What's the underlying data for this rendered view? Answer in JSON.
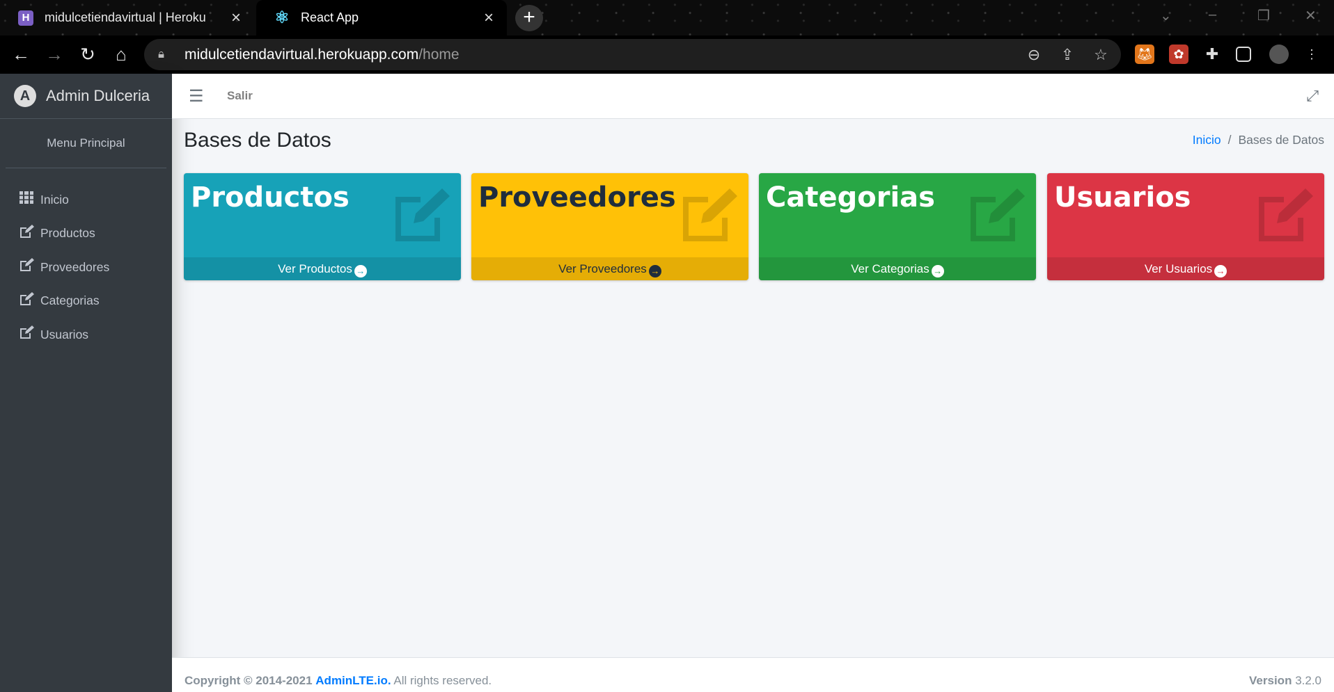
{
  "browser": {
    "tabs": [
      {
        "title": "midulcetiendavirtual | Heroku",
        "favicon": "heroku-icon"
      },
      {
        "title": "React App",
        "favicon": "react-icon"
      }
    ],
    "url_host": "midulcetiendavirtual.herokuapp.com",
    "url_path": "/home"
  },
  "sidebar": {
    "brand": "Admin Dulceria",
    "menu_title": "Menu Principal",
    "items": [
      {
        "label": "Inicio",
        "icon": "grid-icon"
      },
      {
        "label": "Productos",
        "icon": "edit-icon"
      },
      {
        "label": "Proveedores",
        "icon": "edit-icon"
      },
      {
        "label": "Categorias",
        "icon": "edit-icon"
      },
      {
        "label": "Usuarios",
        "icon": "edit-icon"
      }
    ]
  },
  "topnav": {
    "salir": "Salir"
  },
  "content": {
    "title": "Bases de Datos",
    "breadcrumb": {
      "home": "Inicio",
      "current": "Bases de Datos"
    }
  },
  "boxes": [
    {
      "title": "Productos",
      "link": "Ver Productos",
      "color": "#17a2b8",
      "text_color": "#ffffff"
    },
    {
      "title": "Proveedores",
      "link": "Ver Proveedores",
      "color": "#ffc107",
      "text_color": "#1f2d3d"
    },
    {
      "title": "Categorias",
      "link": "Ver Categorias",
      "color": "#28a745",
      "text_color": "#ffffff"
    },
    {
      "title": "Usuarios",
      "link": "Ver Usuarios",
      "color": "#dc3545",
      "text_color": "#ffffff"
    }
  ],
  "footer": {
    "copyright_prefix": "Copyright © 2014-2021",
    "brand": "AdminLTE.io.",
    "rights": "All rights reserved.",
    "version_label": "Version",
    "version": "3.2.0"
  }
}
